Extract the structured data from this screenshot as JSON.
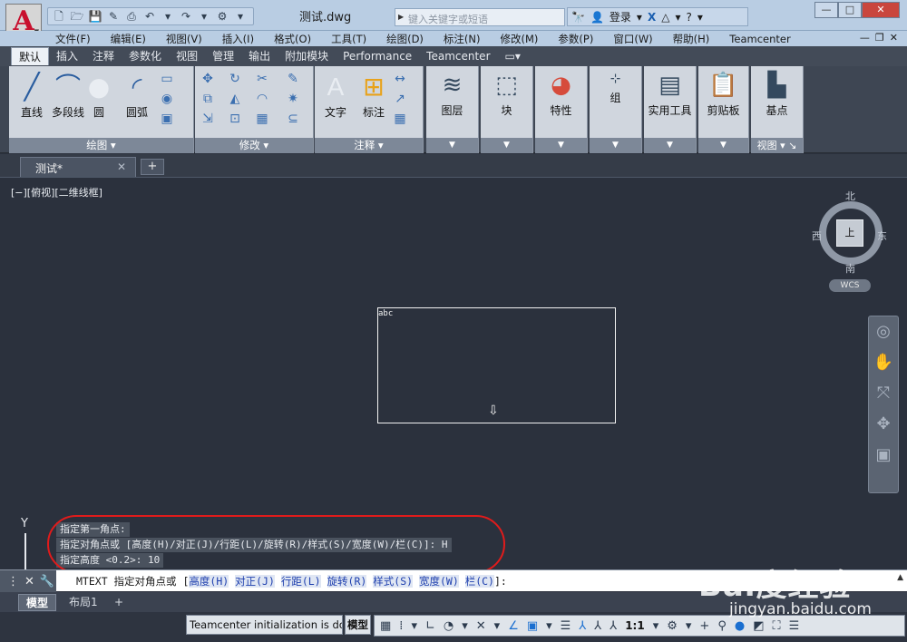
{
  "app": {
    "logo_letter": "A",
    "document_title": "测试.dwg",
    "search_placeholder": "键入关键字或短语",
    "login_label": "登录"
  },
  "menu": {
    "items": [
      "文件(F)",
      "编辑(E)",
      "视图(V)",
      "插入(I)",
      "格式(O)",
      "工具(T)",
      "绘图(D)",
      "标注(N)",
      "修改(M)",
      "参数(P)",
      "窗口(W)",
      "帮助(H)",
      "Teamcenter"
    ]
  },
  "ribbon_tabs": {
    "items": [
      "默认",
      "插入",
      "注释",
      "参数化",
      "视图",
      "管理",
      "输出",
      "附加模块",
      "Performance",
      "Teamcenter"
    ],
    "active": "默认"
  },
  "ribbon": {
    "draw_panel": {
      "title": "绘图",
      "tools": [
        "直线",
        "多段线",
        "圆",
        "圆弧"
      ]
    },
    "modify_panel": {
      "title": "修改"
    },
    "annotation_panel": {
      "title": "注释",
      "tools": [
        "文字",
        "标注"
      ]
    },
    "layers_label": "图层",
    "block_label": "块",
    "properties_label": "特性",
    "group_label": "组",
    "utilities_label": "实用工具",
    "clipboard_label": "剪贴板",
    "view_panel": {
      "basepoint_label": "基点",
      "title": "视图"
    }
  },
  "file_tabs": {
    "active": "测试*"
  },
  "drawing": {
    "viewport_label": "[−][俯视][二维线框]",
    "mtext_sample": "abc",
    "viewcube": {
      "north": "北",
      "south": "南",
      "east": "东",
      "west": "西",
      "face": "上",
      "wcs": "WCS"
    },
    "ucs_axis": "Y"
  },
  "command_history": [
    "指定第一角点:",
    "指定对角点或 [高度(H)/对正(J)/行距(L)/旋转(R)/样式(S)/宽度(W)/栏(C)]: H",
    "指定高度 <0.2>: 10"
  ],
  "command_line": {
    "prefix": "MTEXT 指定对角点或 [",
    "options": [
      {
        "text": "高度(H)",
        "key": "H"
      },
      {
        "text": "对正(J)",
        "key": "J"
      },
      {
        "text": "行距(L)",
        "key": "L"
      },
      {
        "text": "旋转(R)",
        "key": "R"
      },
      {
        "text": "样式(S)",
        "key": "S"
      },
      {
        "text": "宽度(W)",
        "key": "W"
      },
      {
        "text": "栏(C)",
        "key": "C"
      }
    ],
    "suffix": "]:"
  },
  "layout_tabs": {
    "items": [
      "模型",
      "布局1"
    ],
    "active": "模型"
  },
  "status_bar": {
    "message": "Teamcenter initialization is done",
    "model_label": "模型",
    "scale": "1:1"
  },
  "watermark": {
    "brand": "Bai度经验",
    "site": "jingyan.baidu.com"
  }
}
